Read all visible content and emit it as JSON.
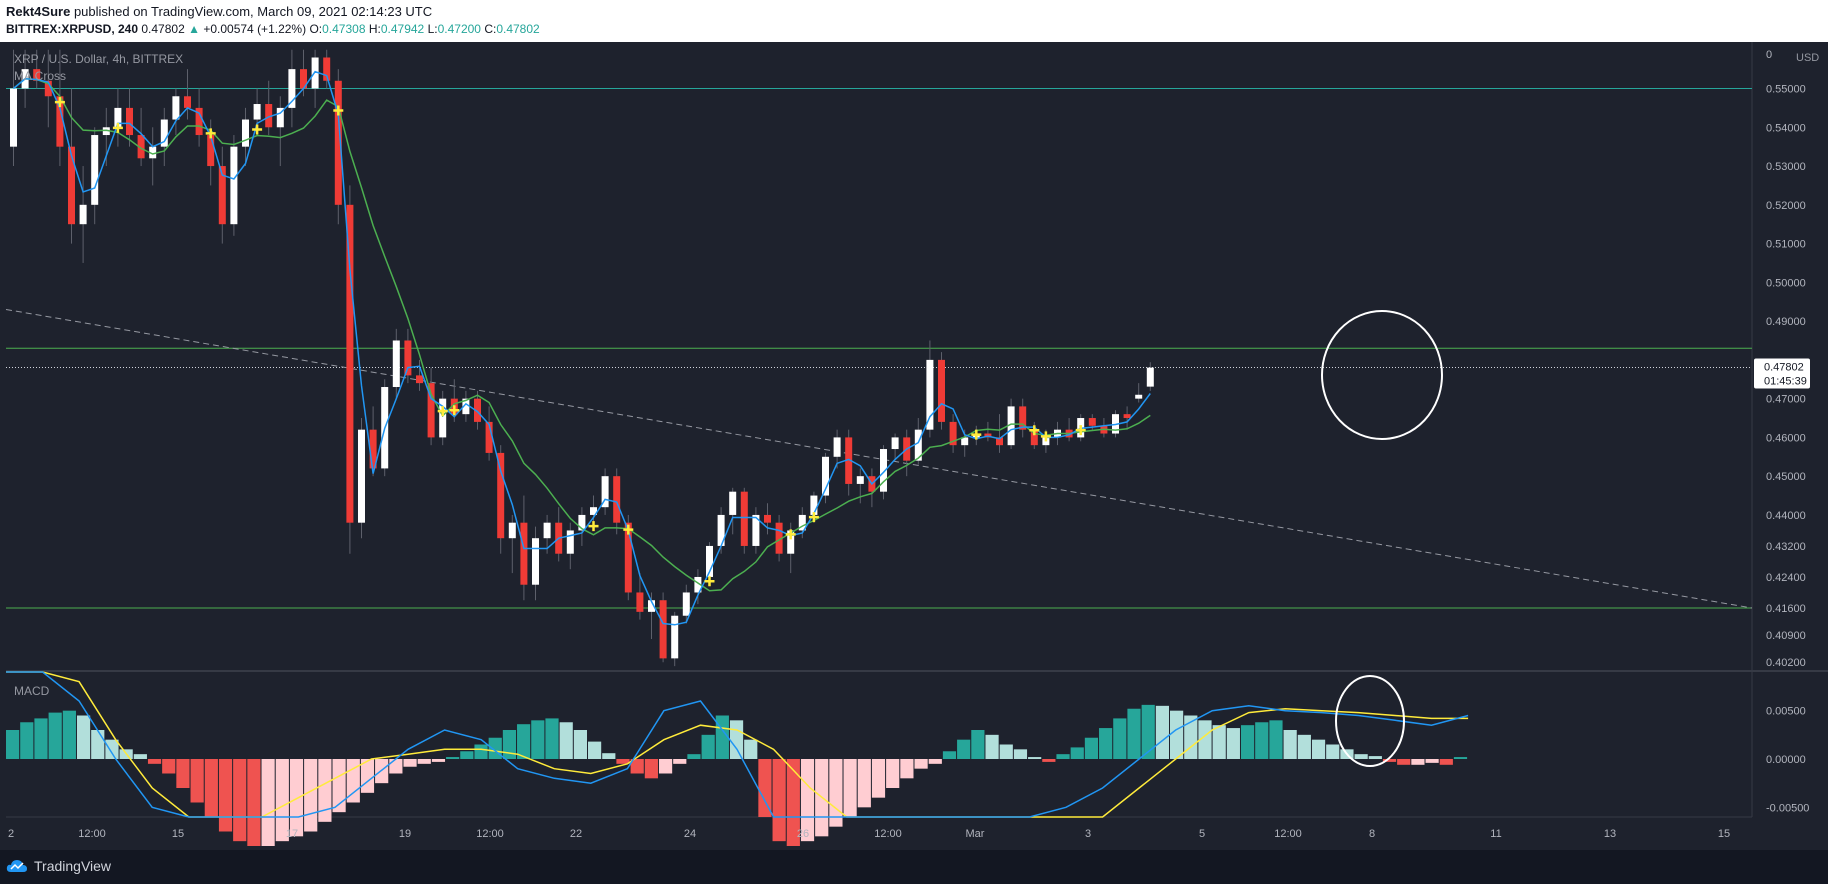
{
  "header": {
    "author": "Rekt4Sure",
    "published_text": "published on TradingView.com, March 09, 2021 02:14:23 UTC",
    "symbol": "BITTREX:XRPUSD, 240",
    "last": "0.47802",
    "change": "+0.00574 (+1.22%)",
    "o_label": "O:",
    "o": "0.47308",
    "h_label": "H:",
    "h": "0.47942",
    "l_label": "L:",
    "l": "0.47200",
    "c_label": "C:",
    "c": "0.47802"
  },
  "pane": {
    "title": "XRP / U.S. Dollar, 4h, BITTREX",
    "indicator": "MA Cross",
    "macd_label": "MACD",
    "currency": "USD"
  },
  "price_axis": {
    "ticks": [
      "0.55000",
      "0.54000",
      "0.53000",
      "0.52000",
      "0.51000",
      "0.50000",
      "0.49000",
      "0.47000",
      "0.46000",
      "0.45000",
      "0.44000",
      "0.43200",
      "0.42400",
      "0.41600",
      "0.40900",
      "0.40200"
    ],
    "top_tick": "0",
    "current_price": "0.47802",
    "countdown": "01:45:39"
  },
  "macd_axis": {
    "ticks": [
      "0.00500",
      "0.00000",
      "-0.00500"
    ]
  },
  "time_axis": {
    "labels": [
      "2",
      "12:00",
      "15",
      "17",
      "19",
      "12:00",
      "22",
      "24",
      "26",
      "12:00",
      "Mar",
      "3",
      "5",
      "12:00",
      "8",
      "11",
      "13",
      "15"
    ]
  },
  "colors": {
    "up": "#ffffff",
    "down": "#ef3b36",
    "fast_ma": "#2196f3",
    "slow_ma": "#4caf50",
    "macd_line": "#2196f3",
    "signal_line": "#ffeb3b",
    "hist_pos_strong": "#26a69a",
    "hist_pos_weak": "#b2dfdb",
    "hist_neg_strong": "#ef5350",
    "hist_neg_weak": "#ffcdd2",
    "background": "#1e222d"
  },
  "chart_data": {
    "type": "candlestick",
    "timeframe": "4h",
    "symbol": "XRP / U.S. Dollar",
    "candles": [
      [
        0.535,
        0.56,
        0.53,
        0.55
      ],
      [
        0.55,
        0.56,
        0.545,
        0.555
      ],
      [
        0.555,
        0.56,
        0.55,
        0.552
      ],
      [
        0.552,
        0.56,
        0.54,
        0.548
      ],
      [
        0.548,
        0.56,
        0.53,
        0.535
      ],
      [
        0.535,
        0.55,
        0.51,
        0.515
      ],
      [
        0.515,
        0.53,
        0.505,
        0.52
      ],
      [
        0.52,
        0.54,
        0.515,
        0.538
      ],
      [
        0.538,
        0.545,
        0.53,
        0.54
      ],
      [
        0.54,
        0.55,
        0.535,
        0.545
      ],
      [
        0.545,
        0.55,
        0.535,
        0.538
      ],
      [
        0.538,
        0.545,
        0.53,
        0.532
      ],
      [
        0.532,
        0.54,
        0.525,
        0.535
      ],
      [
        0.535,
        0.545,
        0.53,
        0.542
      ],
      [
        0.542,
        0.55,
        0.538,
        0.548
      ],
      [
        0.548,
        0.555,
        0.542,
        0.545
      ],
      [
        0.545,
        0.55,
        0.535,
        0.538
      ],
      [
        0.538,
        0.542,
        0.525,
        0.53
      ],
      [
        0.53,
        0.535,
        0.51,
        0.515
      ],
      [
        0.515,
        0.538,
        0.512,
        0.535
      ],
      [
        0.535,
        0.545,
        0.53,
        0.542
      ],
      [
        0.542,
        0.55,
        0.538,
        0.546
      ],
      [
        0.546,
        0.552,
        0.538,
        0.54
      ],
      [
        0.54,
        0.548,
        0.53,
        0.545
      ],
      [
        0.545,
        0.56,
        0.54,
        0.555
      ],
      [
        0.555,
        0.56,
        0.548,
        0.55
      ],
      [
        0.55,
        0.56,
        0.545,
        0.558
      ],
      [
        0.558,
        0.56,
        0.55,
        0.552
      ],
      [
        0.552,
        0.555,
        0.515,
        0.52
      ],
      [
        0.52,
        0.525,
        0.43,
        0.438
      ],
      [
        0.438,
        0.465,
        0.434,
        0.462
      ],
      [
        0.462,
        0.468,
        0.45,
        0.452
      ],
      [
        0.452,
        0.475,
        0.45,
        0.473
      ],
      [
        0.473,
        0.488,
        0.47,
        0.485
      ],
      [
        0.485,
        0.488,
        0.474,
        0.476
      ],
      [
        0.476,
        0.48,
        0.472,
        0.474
      ],
      [
        0.474,
        0.478,
        0.458,
        0.46
      ],
      [
        0.46,
        0.472,
        0.458,
        0.47
      ],
      [
        0.47,
        0.475,
        0.464,
        0.466
      ],
      [
        0.466,
        0.472,
        0.464,
        0.47
      ],
      [
        0.47,
        0.472,
        0.462,
        0.464
      ],
      [
        0.464,
        0.468,
        0.454,
        0.456
      ],
      [
        0.456,
        0.458,
        0.43,
        0.434
      ],
      [
        0.434,
        0.44,
        0.425,
        0.438
      ],
      [
        0.438,
        0.445,
        0.418,
        0.422
      ],
      [
        0.422,
        0.437,
        0.418,
        0.434
      ],
      [
        0.434,
        0.44,
        0.43,
        0.438
      ],
      [
        0.438,
        0.442,
        0.428,
        0.43
      ],
      [
        0.43,
        0.438,
        0.426,
        0.436
      ],
      [
        0.436,
        0.442,
        0.432,
        0.44
      ],
      [
        0.44,
        0.445,
        0.437,
        0.442
      ],
      [
        0.442,
        0.452,
        0.44,
        0.45
      ],
      [
        0.45,
        0.452,
        0.435,
        0.438
      ],
      [
        0.438,
        0.44,
        0.418,
        0.42
      ],
      [
        0.42,
        0.425,
        0.413,
        0.415
      ],
      [
        0.415,
        0.42,
        0.408,
        0.418
      ],
      [
        0.418,
        0.42,
        0.402,
        0.403
      ],
      [
        0.403,
        0.415,
        0.401,
        0.414
      ],
      [
        0.414,
        0.422,
        0.412,
        0.42
      ],
      [
        0.42,
        0.426,
        0.417,
        0.424
      ],
      [
        0.424,
        0.433,
        0.422,
        0.432
      ],
      [
        0.432,
        0.442,
        0.43,
        0.44
      ],
      [
        0.44,
        0.447,
        0.435,
        0.446
      ],
      [
        0.446,
        0.447,
        0.43,
        0.432
      ],
      [
        0.432,
        0.442,
        0.43,
        0.44
      ],
      [
        0.44,
        0.443,
        0.435,
        0.438
      ],
      [
        0.438,
        0.44,
        0.428,
        0.43
      ],
      [
        0.43,
        0.438,
        0.425,
        0.436
      ],
      [
        0.436,
        0.442,
        0.434,
        0.44
      ],
      [
        0.44,
        0.446,
        0.438,
        0.445
      ],
      [
        0.445,
        0.456,
        0.443,
        0.455
      ],
      [
        0.455,
        0.462,
        0.452,
        0.46
      ],
      [
        0.46,
        0.462,
        0.445,
        0.448
      ],
      [
        0.448,
        0.452,
        0.443,
        0.45
      ],
      [
        0.45,
        0.452,
        0.442,
        0.446
      ],
      [
        0.446,
        0.458,
        0.444,
        0.457
      ],
      [
        0.457,
        0.461,
        0.454,
        0.46
      ],
      [
        0.46,
        0.462,
        0.45,
        0.454
      ],
      [
        0.454,
        0.465,
        0.453,
        0.462
      ],
      [
        0.462,
        0.485,
        0.46,
        0.48
      ],
      [
        0.48,
        0.482,
        0.462,
        0.464
      ],
      [
        0.464,
        0.466,
        0.456,
        0.458
      ],
      [
        0.458,
        0.462,
        0.455,
        0.46
      ],
      [
        0.46,
        0.463,
        0.458,
        0.461
      ],
      [
        0.461,
        0.464,
        0.459,
        0.46
      ],
      [
        0.46,
        0.466,
        0.456,
        0.458
      ],
      [
        0.458,
        0.47,
        0.457,
        0.468
      ],
      [
        0.468,
        0.47,
        0.46,
        0.462
      ],
      [
        0.462,
        0.464,
        0.457,
        0.458
      ],
      [
        0.458,
        0.462,
        0.456,
        0.46
      ],
      [
        0.46,
        0.464,
        0.458,
        0.462
      ],
      [
        0.462,
        0.465,
        0.459,
        0.46
      ],
      [
        0.46,
        0.466,
        0.459,
        0.465
      ],
      [
        0.465,
        0.466,
        0.462,
        0.463
      ],
      [
        0.463,
        0.465,
        0.46,
        0.461
      ],
      [
        0.461,
        0.467,
        0.46,
        0.466
      ],
      [
        0.466,
        0.468,
        0.462,
        0.465
      ],
      [
        0.47,
        0.474,
        0.469,
        0.471
      ],
      [
        0.4731,
        0.4794,
        0.472,
        0.478
      ]
    ],
    "levels": [
      0.55,
      0.483,
      0.416
    ],
    "macd": {
      "histogram": [
        0.003,
        0.0038,
        0.0042,
        0.0048,
        0.005,
        0.0045,
        0.003,
        0.002,
        0.001,
        0.0005,
        -0.0005,
        -0.0015,
        -0.003,
        -0.0045,
        -0.006,
        -0.0075,
        -0.0085,
        -0.009,
        -0.009,
        -0.0085,
        -0.008,
        -0.0075,
        -0.0065,
        -0.0055,
        -0.0045,
        -0.0035,
        -0.0025,
        -0.0015,
        -0.0008,
        -0.0005,
        -0.0003,
        0.0002,
        0.0008,
        0.0015,
        0.0022,
        0.003,
        0.0036,
        0.004,
        0.0042,
        0.0038,
        0.003,
        0.0018,
        0.0006,
        -0.0005,
        -0.0015,
        -0.002,
        -0.0015,
        -0.0005,
        0.0005,
        0.0025,
        0.0045,
        0.004,
        0.002,
        -0.006,
        -0.0085,
        -0.009,
        -0.0085,
        -0.008,
        -0.007,
        -0.006,
        -0.005,
        -0.004,
        -0.003,
        -0.002,
        -0.001,
        -0.0005,
        0.0008,
        0.002,
        0.003,
        0.0025,
        0.0015,
        0.001,
        0.0002,
        -0.0003,
        0.0005,
        0.0012,
        0.0022,
        0.0032,
        0.0042,
        0.0052,
        0.0056,
        0.0055,
        0.005,
        0.0045,
        0.004,
        0.0035,
        0.0032,
        0.0035,
        0.0038,
        0.004,
        0.003,
        0.0025,
        0.002,
        0.0015,
        0.001,
        0.0005,
        0.0003,
        -0.0003,
        -0.0006,
        -0.0006,
        -0.0004,
        -0.0006,
        0.0002
      ],
      "macd_line": [
        0.016,
        0.012,
        0.006,
        0.0,
        -0.005,
        -0.009,
        -0.011,
        -0.01,
        -0.008,
        -0.005,
        -0.002,
        0.001,
        0.003,
        0.002,
        -0.001,
        -0.002,
        -0.0025,
        -0.001,
        0.005,
        0.006,
        0.001,
        -0.006,
        -0.012,
        -0.017,
        -0.021,
        -0.023,
        -0.022,
        -0.015,
        -0.009,
        -0.005,
        -0.003,
        0.0,
        0.003,
        0.005,
        0.0055,
        0.005,
        0.0048,
        0.0045,
        0.004,
        0.0035,
        0.0045
      ],
      "signal_line": [
        0.02,
        0.015,
        0.008,
        0.002,
        -0.003,
        -0.006,
        -0.007,
        -0.006,
        -0.004,
        -0.002,
        0.0,
        0.0005,
        0.001,
        0.001,
        0.0005,
        -0.001,
        -0.0015,
        -0.0005,
        0.002,
        0.0035,
        0.003,
        0.001,
        -0.003,
        -0.008,
        -0.013,
        -0.017,
        -0.0185,
        -0.017,
        -0.014,
        -0.01,
        -0.006,
        -0.003,
        0.0,
        0.003,
        0.0048,
        0.0052,
        0.005,
        0.0048,
        0.0045,
        0.0042,
        0.0042
      ],
      "ylim": [
        -0.006,
        0.009
      ]
    },
    "ylim": [
      0.4,
      0.562
    ]
  }
}
